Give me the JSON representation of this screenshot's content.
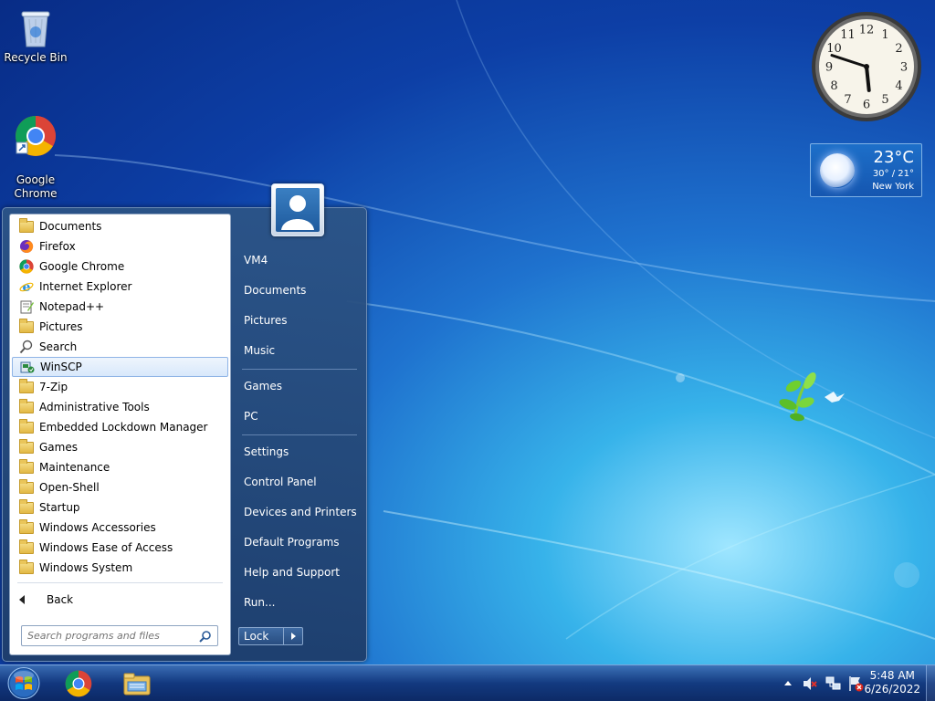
{
  "desktop": {
    "icons": [
      {
        "label": "Recycle Bin"
      },
      {
        "label": "Google\nChrome"
      }
    ]
  },
  "weather": {
    "temp": "23°C",
    "range": "30° / 21°",
    "city": "New York"
  },
  "clock_gadget": {
    "numbers": [
      "12",
      "1",
      "2",
      "3",
      "4",
      "5",
      "6",
      "7",
      "8",
      "9",
      "10",
      "11"
    ],
    "hour": 5,
    "minute": 48
  },
  "start_menu": {
    "programs": [
      {
        "label": "Documents",
        "icon": "folder-icon"
      },
      {
        "label": "Firefox",
        "icon": "firefox-icon"
      },
      {
        "label": "Google Chrome",
        "icon": "chrome-icon"
      },
      {
        "label": "Internet Explorer",
        "icon": "ie-icon"
      },
      {
        "label": "Notepad++",
        "icon": "notepadpp-icon"
      },
      {
        "label": "Pictures",
        "icon": "folder-icon"
      },
      {
        "label": "Search",
        "icon": "search-icon"
      },
      {
        "label": "WinSCP",
        "icon": "winscp-icon",
        "selected": true
      },
      {
        "label": "7-Zip",
        "icon": "folder-icon"
      },
      {
        "label": "Administrative Tools",
        "icon": "folder-icon"
      },
      {
        "label": "Embedded Lockdown Manager",
        "icon": "folder-icon"
      },
      {
        "label": "Games",
        "icon": "folder-icon"
      },
      {
        "label": "Maintenance",
        "icon": "folder-icon"
      },
      {
        "label": "Open-Shell",
        "icon": "folder-icon"
      },
      {
        "label": "Startup",
        "icon": "folder-icon"
      },
      {
        "label": "Windows Accessories",
        "icon": "folder-icon"
      },
      {
        "label": "Windows Ease of Access",
        "icon": "folder-icon"
      },
      {
        "label": "Windows System",
        "icon": "folder-icon"
      }
    ],
    "back_label": "Back",
    "search_placeholder": "Search programs and files",
    "right": {
      "user": "VM4",
      "documents": "Documents",
      "pictures": "Pictures",
      "music": "Music",
      "games": "Games",
      "pc": "PC",
      "settings": "Settings",
      "control_panel": "Control Panel",
      "devices_printers": "Devices and Printers",
      "default_programs": "Default Programs",
      "help_support": "Help and Support",
      "run": "Run..."
    },
    "lock_label": "Lock"
  },
  "taskbar": {
    "time": "5:48 AM",
    "date": "6/26/2022"
  }
}
